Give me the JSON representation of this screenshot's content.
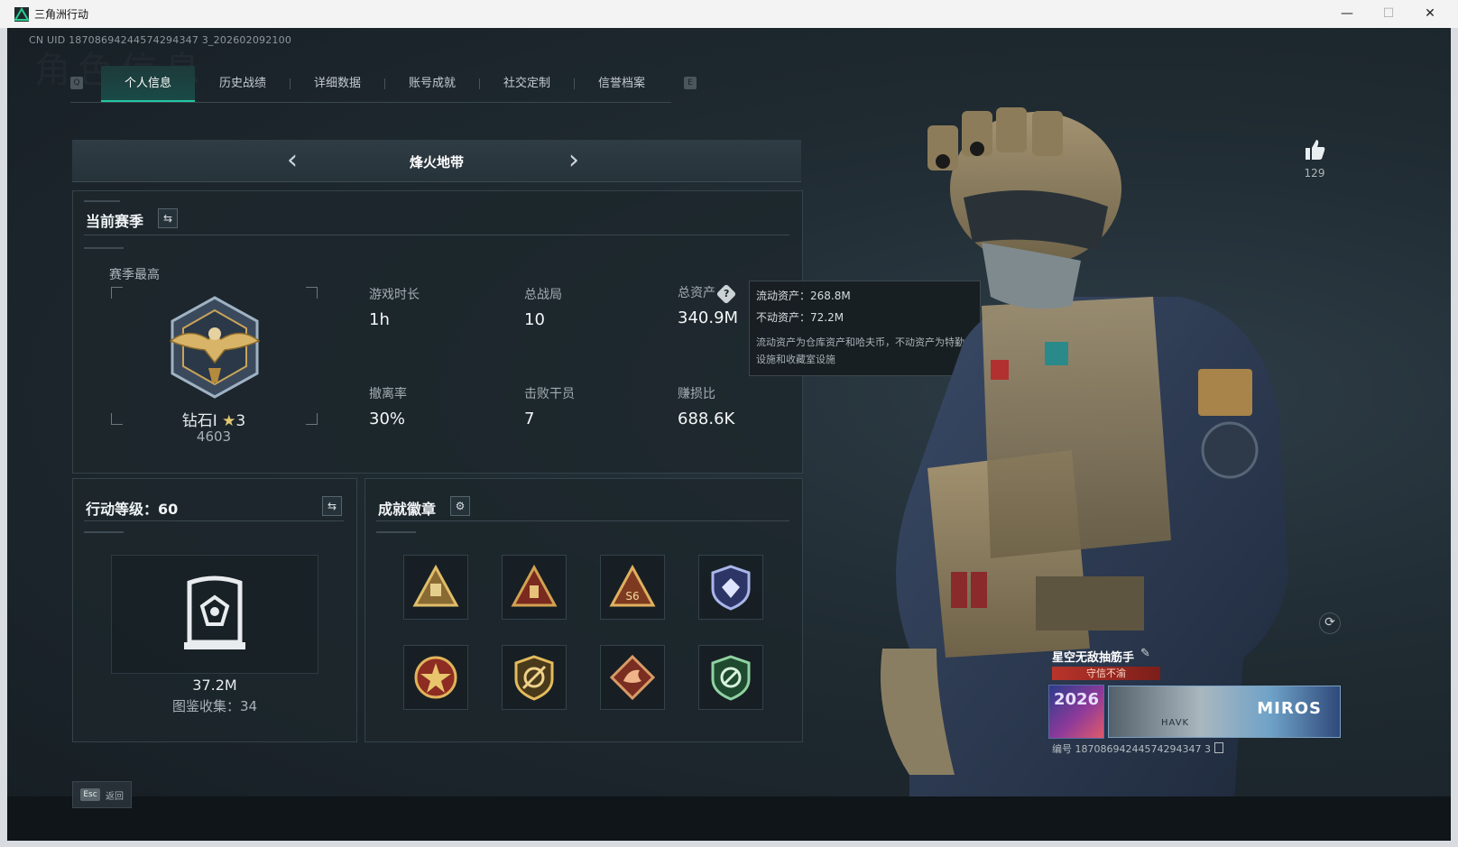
{
  "window": {
    "title": "三角洲行动",
    "minimize": "—",
    "maximize": "☐",
    "close": "✕"
  },
  "header": {
    "uid": "CN UID 18708694244574294347 3_202602092100",
    "watermark": "角色信息"
  },
  "tabs": {
    "key_prev": "Q",
    "key_next": "E",
    "items": [
      {
        "label": "个人信息",
        "active": true
      },
      {
        "label": "历史战绩",
        "active": false
      },
      {
        "label": "详细数据",
        "active": false
      },
      {
        "label": "账号成就",
        "active": false
      },
      {
        "label": "社交定制",
        "active": false
      },
      {
        "label": "信誉档案",
        "active": false
      }
    ]
  },
  "mode": {
    "title": "烽火地带",
    "prev": "‹",
    "next": "›"
  },
  "season": {
    "title": "当前赛季",
    "switch_icon": "⇆",
    "best_label": "赛季最高",
    "rank_name": "钻石I",
    "rank_stars": "3",
    "rank_score": "4603",
    "stats": [
      {
        "label": "游戏时长",
        "value": "1h"
      },
      {
        "label": "总战局",
        "value": "10"
      },
      {
        "label": "总资产",
        "value": "340.9M"
      },
      {
        "label": "撤离率",
        "value": "30%"
      },
      {
        "label": "击败干员",
        "value": "7"
      },
      {
        "label": "赚损比",
        "value": "688.6K"
      }
    ],
    "help": "?"
  },
  "tooltip": {
    "liquid": "流动资产：268.8M",
    "fixed": "不动资产：72.2M",
    "note": "流动资产为仓库资产和哈夫币，不动资产为特勤处设施和收藏室设施"
  },
  "level": {
    "title": "行动等级：60",
    "switch_icon": "⇆",
    "value": "37.2M",
    "collect": "图鉴收集：34"
  },
  "badges": {
    "title": "成就徽章",
    "settings_icon": "⚙",
    "items": [
      {
        "icon": "tri-badge-gold-icon",
        "color": "#c49a4a"
      },
      {
        "icon": "tri-badge-red-icon",
        "color": "#b7452f"
      },
      {
        "icon": "tri-badge-s6-icon",
        "color": "#c08a3a"
      },
      {
        "icon": "shield-badge-blue-icon",
        "color": "#5a6fc0"
      },
      {
        "icon": "star-badge-red-icon",
        "color": "#c0452f"
      },
      {
        "icon": "shield-badge-gold-icon",
        "color": "#c69a3e"
      },
      {
        "icon": "dragon-badge-red-icon",
        "color": "#b0503a"
      },
      {
        "icon": "shield-badge-green-icon",
        "color": "#3f8f5a"
      }
    ]
  },
  "profile": {
    "likes": "129",
    "refresh_icon": "⟳",
    "player_name": "星空无敌抽筋手",
    "edit_icon": "✎",
    "credit": "守信不渝",
    "avatar_text": "2026",
    "card_brand": "MIROS",
    "card_text": "HAVK",
    "player_id": "编号 18708694244574294347 3"
  },
  "footer": {
    "esc_key": "Esc",
    "esc_label": "返回"
  },
  "colors": {
    "accent": "#23c7a2",
    "background": "#1f2a31"
  }
}
